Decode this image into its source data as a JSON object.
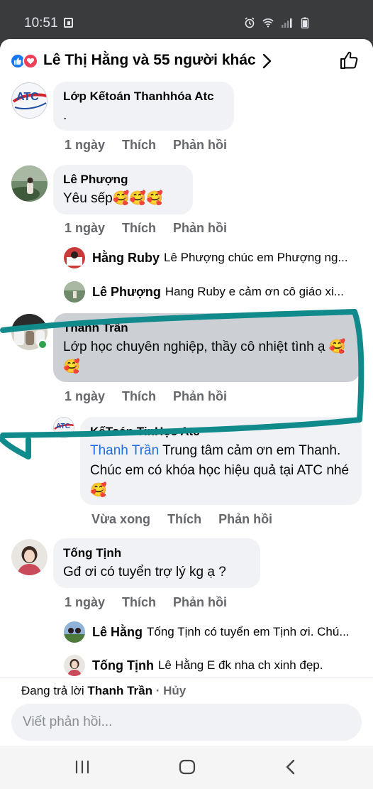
{
  "status_bar": {
    "time": "10:51"
  },
  "header": {
    "reactions_text": "Lê Thị Hằng và 55 người khác"
  },
  "comments": [
    {
      "author": "Lớp Kếtoán Thanhhóa Atc",
      "text": ".",
      "time": "1 ngày",
      "like": "Thích",
      "reply": "Phản hồi"
    },
    {
      "author": "Lê Phượng",
      "text": "Yêu sếp🥰🥰🥰",
      "time": "1 ngày",
      "like": "Thích",
      "reply": "Phản hồi",
      "replies": [
        {
          "name": "Hằng Ruby",
          "text": "Lê Phượng chúc em Phượng ng..."
        },
        {
          "name": "Lê Phượng",
          "text": "Hang Ruby e cảm ơn cô giáo xi..."
        }
      ]
    },
    {
      "author": "Thanh Trần",
      "text": "Lớp học chuyên nghiệp, thầy cô nhiệt tình ạ 🥰🥰",
      "time": "1 ngày",
      "like": "Thích",
      "reply": "Phản hồi",
      "replies_full": [
        {
          "author": "KếToán TinHọc Atc",
          "mention": "Thanh Trần",
          "text": " Trung tâm cảm ơn em Thanh. Chúc em có khóa học hiệu quả tại ATC nhé 🥰",
          "time": "Vừa xong",
          "like": "Thích",
          "reply": "Phản hồi"
        }
      ]
    },
    {
      "author": "Tống Tịnh",
      "text": "Gđ ơi có tuyển trợ lý kg ạ ?",
      "time": "1 ngày",
      "like": "Thích",
      "reply": "Phản hồi",
      "replies": [
        {
          "name": "Lê Hằng",
          "text": "Tống Tịnh có tuyển em Tịnh ơi. Chú..."
        },
        {
          "name": "Tống Tịnh",
          "text": "Lê Hằng E đk nha ch xinh đẹp."
        }
      ]
    }
  ],
  "composer": {
    "replying_prefix": "Đang trả lời",
    "replying_to": "Thanh Trần",
    "cancel": "· Hủy",
    "placeholder": "Viết phản hồi..."
  },
  "colors": {
    "accent": "#1877f2",
    "mention": "#216fdb",
    "highlight": "#118a8c"
  }
}
